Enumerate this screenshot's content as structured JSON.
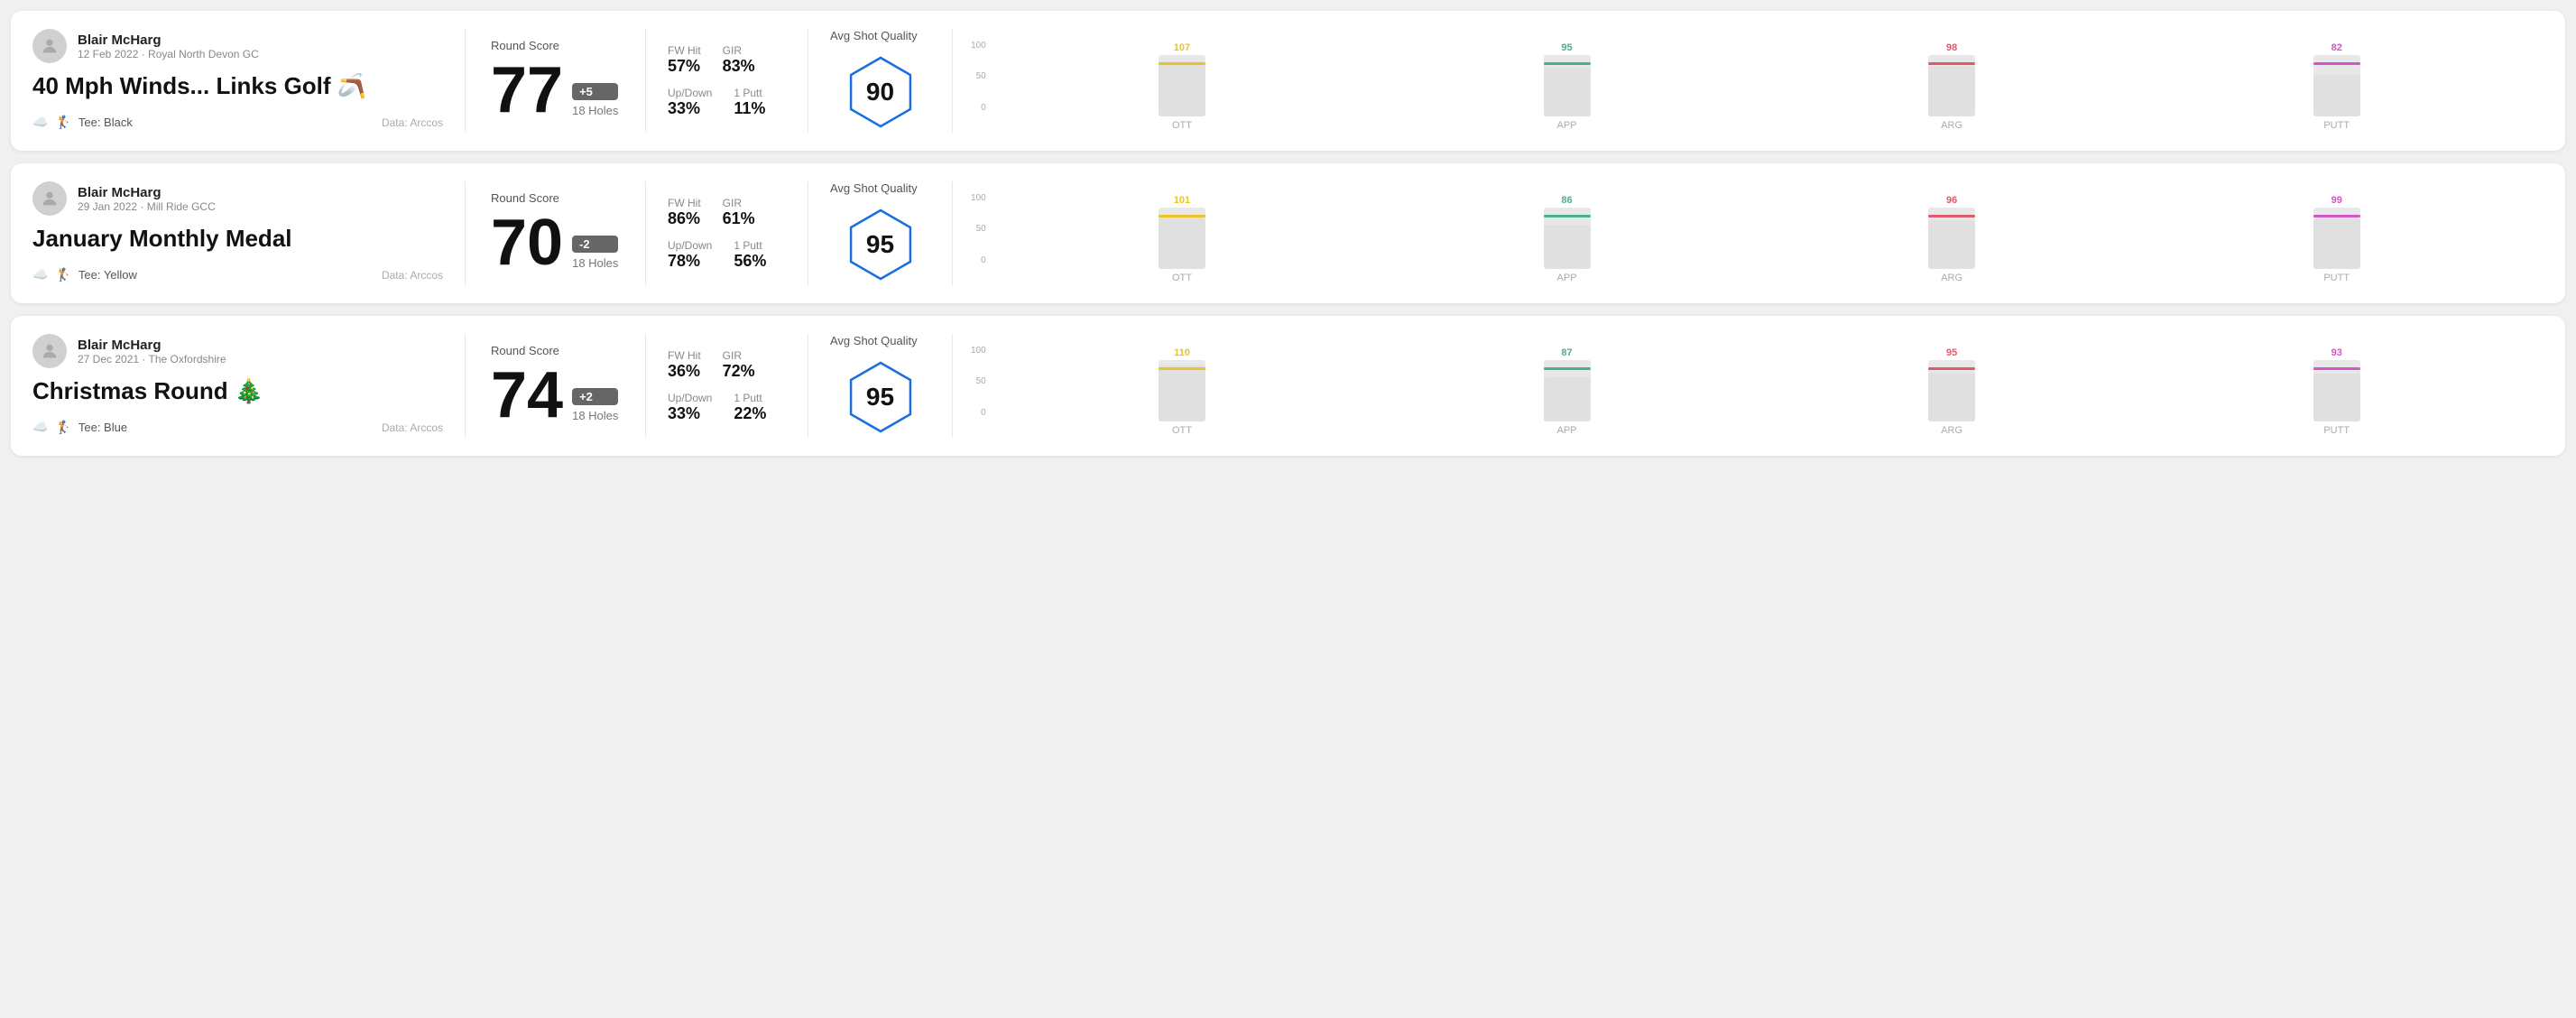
{
  "rounds": [
    {
      "player": "Blair McHarg",
      "date": "12 Feb 2022 · Royal North Devon GC",
      "title": "40 Mph Winds... Links Golf 🪃",
      "tee": "Black",
      "data_source": "Data: Arccos",
      "score": "77",
      "score_diff": "+5",
      "holes": "18 Holes",
      "fw_hit": "57%",
      "gir": "83%",
      "up_down": "33%",
      "one_putt": "11%",
      "avg_quality_label": "Avg Shot Quality",
      "quality_score": "90",
      "chart": {
        "ott": {
          "value": 107,
          "color": "#e8c42a"
        },
        "app": {
          "value": 95,
          "color": "#4caf87"
        },
        "arg": {
          "value": 98,
          "color": "#e05a6a"
        },
        "putt": {
          "value": 82,
          "color": "#d455c8"
        }
      }
    },
    {
      "player": "Blair McHarg",
      "date": "29 Jan 2022 · Mill Ride GCC",
      "title": "January Monthly Medal",
      "tee": "Yellow",
      "data_source": "Data: Arccos",
      "score": "70",
      "score_diff": "-2",
      "holes": "18 Holes",
      "fw_hit": "86%",
      "gir": "61%",
      "up_down": "78%",
      "one_putt": "56%",
      "avg_quality_label": "Avg Shot Quality",
      "quality_score": "95",
      "chart": {
        "ott": {
          "value": 101,
          "color": "#e8c42a"
        },
        "app": {
          "value": 86,
          "color": "#4caf87"
        },
        "arg": {
          "value": 96,
          "color": "#e05a6a"
        },
        "putt": {
          "value": 99,
          "color": "#d455c8"
        }
      }
    },
    {
      "player": "Blair McHarg",
      "date": "27 Dec 2021 · The Oxfordshire",
      "title": "Christmas Round 🎄",
      "tee": "Blue",
      "data_source": "Data: Arccos",
      "score": "74",
      "score_diff": "+2",
      "holes": "18 Holes",
      "fw_hit": "36%",
      "gir": "72%",
      "up_down": "33%",
      "one_putt": "22%",
      "avg_quality_label": "Avg Shot Quality",
      "quality_score": "95",
      "chart": {
        "ott": {
          "value": 110,
          "color": "#e8c42a"
        },
        "app": {
          "value": 87,
          "color": "#4caf87"
        },
        "arg": {
          "value": 95,
          "color": "#e05a6a"
        },
        "putt": {
          "value": 93,
          "color": "#d455c8"
        }
      }
    }
  ],
  "chart_labels": {
    "ott": "OTT",
    "app": "APP",
    "arg": "ARG",
    "putt": "PUTT"
  },
  "y_labels": [
    "100",
    "50",
    "0"
  ]
}
